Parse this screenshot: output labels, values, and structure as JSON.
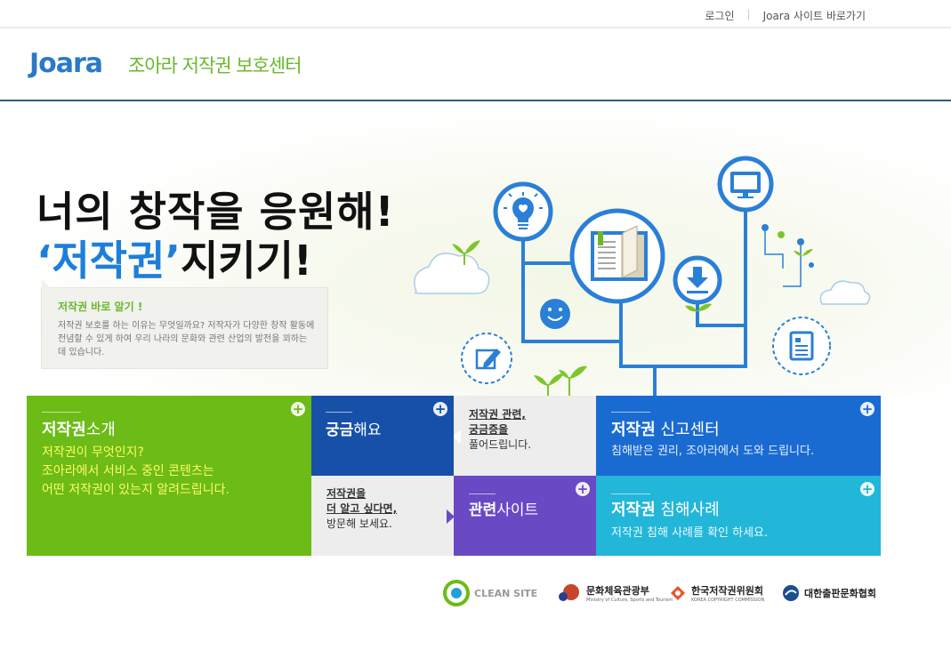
{
  "topbar": {
    "login": "로그인",
    "site_link": "Joara 사이트 바로가기"
  },
  "header": {
    "logo": "Joara",
    "title": "조아라 저작권 보호센터"
  },
  "hero": {
    "headline": "너의 창작을 응원해!",
    "subline_keyword": "저작권",
    "subline_rest": "지키기!",
    "info_title": "저작권 바로 알기 !",
    "info_text": "저작권 보호를 하는 이유는 무엇일까요? 저작자가 다양한 창작 활동에 전념할 수 있게 하여 우리 나라의 문화와 관련 산업의 발전을 꾀하는 데 있습니다."
  },
  "tiles": {
    "intro": {
      "title_bold": "저작권",
      "title_rest": "소개",
      "desc": [
        "저작권이 무엇인지?",
        "조아라에서 서비스 중인 콘텐츠는",
        "어떤 저작권이 있는지 알려드립니다."
      ]
    },
    "curious": {
      "title_bold": "궁금",
      "title_rest": "해요"
    },
    "answer": {
      "line1": "저작권 관련,",
      "line2": "궁금증을",
      "line3": "풀어드립니다."
    },
    "report": {
      "title_bold": "저작권",
      "title_rest": " 신고센터",
      "desc": "침해받은 권리, 조아라에서 도와 드립니다."
    },
    "more": {
      "line1": "저작권을",
      "line2": "더 알고 싶다면,",
      "line3": "방문해 보세요."
    },
    "related": {
      "title_bold": "관련",
      "title_rest": "사이트"
    },
    "cases": {
      "title_bold": "저작권",
      "title_rest": " 침해사례",
      "desc": "저작권 침해 사례를 확인 하세요."
    }
  },
  "partners": {
    "clean_site": "CLEAN SITE",
    "ministry": "문화체육관광부",
    "ministry_sub": "Ministry of Culture, Sports and Tourism",
    "commission": "한국저작권위원회",
    "commission_sub": "KOREA COPYRIGHT COMMISSION",
    "publishers": "대한출판문화협회"
  },
  "colors": {
    "green": "#6cbb16",
    "navy": "#1750a8",
    "blue": "#1a6bd1",
    "purple": "#6a49c4",
    "cyan": "#22b6d8",
    "gray": "#ededed",
    "illus_blue": "#2a7fd6"
  }
}
